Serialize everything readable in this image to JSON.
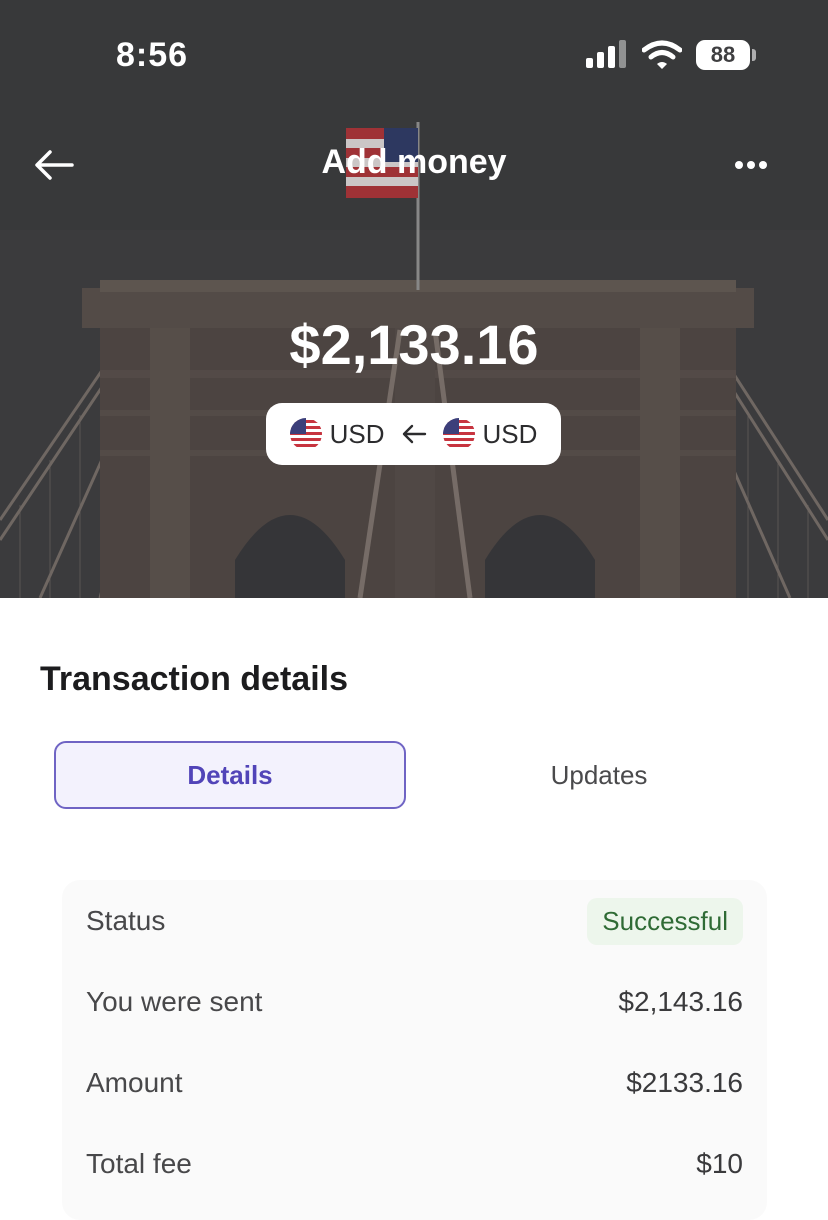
{
  "status_bar": {
    "time": "8:56",
    "battery": "88",
    "icons": [
      "signal-icon",
      "wifi-icon",
      "battery-icon"
    ]
  },
  "header": {
    "title": "Add money",
    "back_icon": "back-arrow-icon",
    "more_icon": "more-dots-icon"
  },
  "hero": {
    "amount": "$2,133.16",
    "currency_to": "USD",
    "currency_from": "USD",
    "direction_icon": "arrow-left-icon",
    "flag_icon": "us-flag-icon"
  },
  "details": {
    "section_title": "Transaction details",
    "tabs": [
      {
        "label": "Details",
        "active": true
      },
      {
        "label": "Updates",
        "active": false
      }
    ],
    "rows": [
      {
        "label": "Status",
        "value": "Successful"
      },
      {
        "label": "You were sent",
        "value": "$2,143.16"
      },
      {
        "label": "Amount",
        "value": "$2133.16"
      },
      {
        "label": "Total fee",
        "value": "$10"
      }
    ]
  },
  "colors": {
    "accent": "#5144b8",
    "accent_border": "#6f64c4",
    "tab_active_bg": "#f3f2fd",
    "success_text": "#2f6b35",
    "success_bg": "#edf6ec",
    "card_bg": "#fafafa"
  }
}
